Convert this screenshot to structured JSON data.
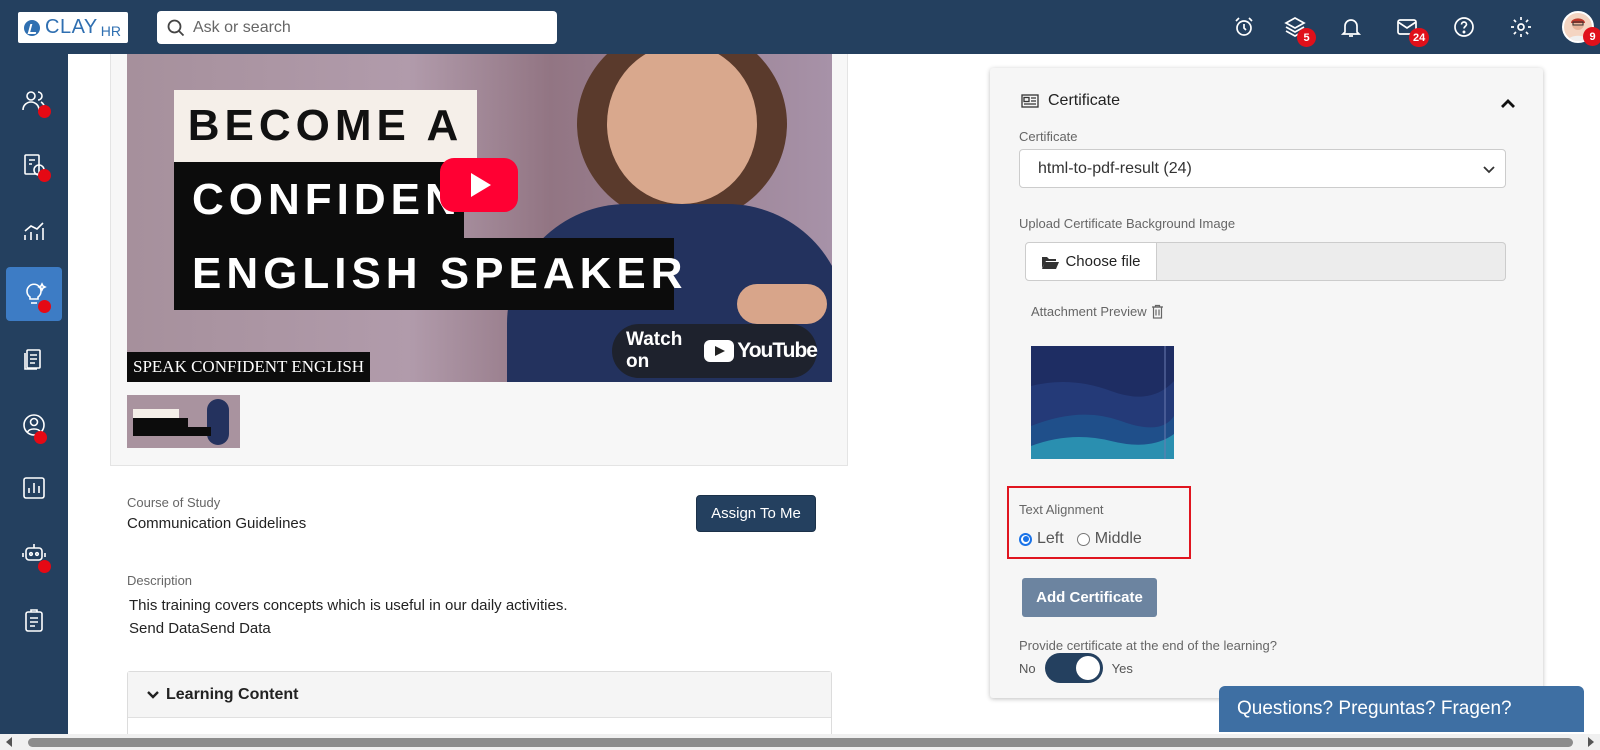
{
  "app": {
    "logo_text": "CLAY",
    "logo_suffix": "HR",
    "search_placeholder": "Ask or search"
  },
  "topbar": {
    "icons": [
      {
        "name": "alarm-clock-icon"
      },
      {
        "name": "layers-icon",
        "badge": "5"
      },
      {
        "name": "bell-icon"
      },
      {
        "name": "mail-icon",
        "badge": "24"
      },
      {
        "name": "help-icon"
      },
      {
        "name": "gear-icon"
      }
    ],
    "avatar_badge": "9"
  },
  "sidebar": {
    "items": [
      {
        "name": "users-icon",
        "dot": true
      },
      {
        "name": "payroll-icon",
        "dot": true
      },
      {
        "name": "growth-chart-icon",
        "dot": false
      },
      {
        "name": "learning-bulb-icon",
        "dot": true,
        "active": true
      },
      {
        "name": "documents-icon",
        "dot": false
      },
      {
        "name": "profile-icon",
        "dot": true
      },
      {
        "name": "reports-icon",
        "dot": false
      },
      {
        "name": "bot-icon",
        "dot": true
      },
      {
        "name": "clipboard-icon",
        "dot": false
      }
    ]
  },
  "video": {
    "line1": "BECOME A",
    "line2": "CONFIDENT",
    "line3": "ENGLISH SPEAKER",
    "watch_on": "Watch on",
    "youtube": "YouTube",
    "caption": "SPEAK CONFIDENT ENGLISH",
    "thumb_line1": "BECOME A",
    "thumb_line2": "CONFIDENT",
    "thumb_line3": "ENGLISH SPEAKER"
  },
  "course": {
    "label": "Course of Study",
    "value": "Communication Guidelines",
    "assign_button": "Assign To Me",
    "description_label": "Description",
    "description_line1": "This training covers concepts which is useful in our daily activities.",
    "description_line2": "Send DataSend Data",
    "learning_content": "Learning Content"
  },
  "certificate": {
    "title": "Certificate",
    "select_label": "Certificate",
    "select_value": "html-to-pdf-result (24)",
    "upload_label": "Upload Certificate Background Image",
    "choose_file": "Choose file",
    "attachment_preview": "Attachment Preview",
    "text_alignment_label": "Text Alignment",
    "alignment_options": [
      "Left",
      "Middle"
    ],
    "alignment_selected": "Left",
    "add_button": "Add Certificate",
    "provide_label": "Provide certificate at the end of the learning?",
    "toggle_no": "No",
    "toggle_yes": "Yes",
    "toggle_state": "on"
  },
  "chat": {
    "label": "Questions? Preguntas? Fragen?"
  },
  "colors": {
    "navy": "#24405f",
    "accent": "#3d7cc5",
    "badge": "#e0101a",
    "highlight": "#e0151f"
  }
}
